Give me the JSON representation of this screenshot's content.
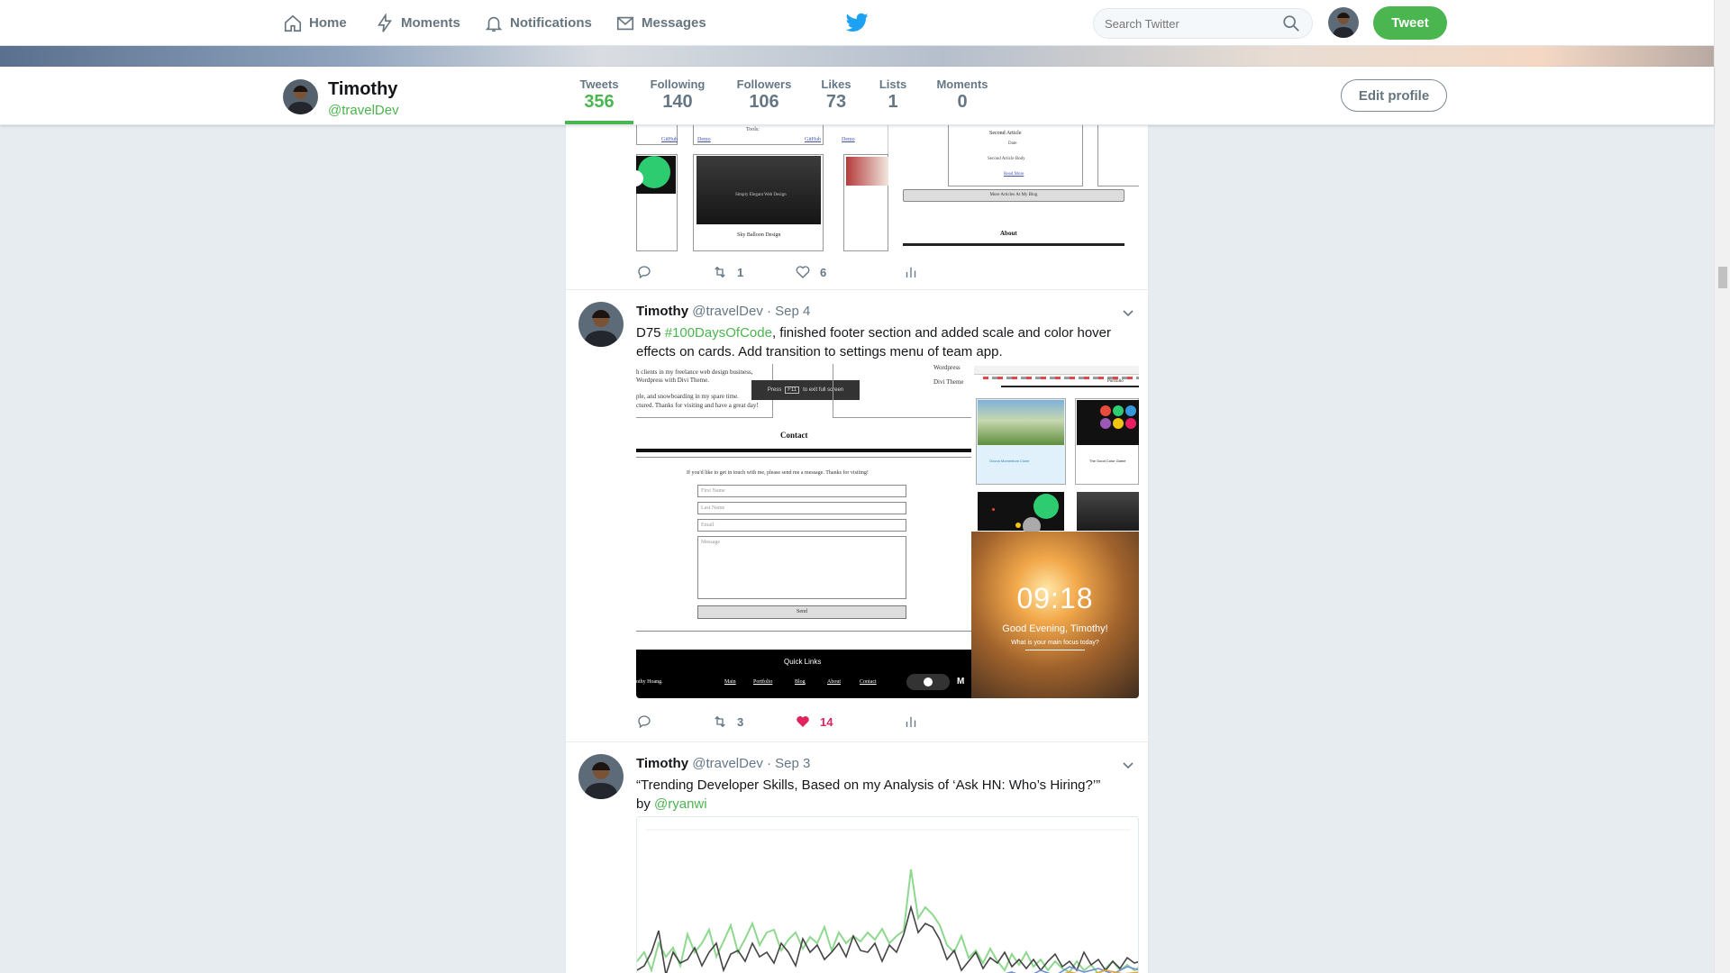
{
  "nav": {
    "home": "Home",
    "moments": "Moments",
    "notifications": "Notifications",
    "messages": "Messages",
    "search_placeholder": "Search Twitter",
    "tweet_button": "Tweet"
  },
  "profile": {
    "name": "Timothy",
    "handle": "@travelDev",
    "edit_button": "Edit profile",
    "stats": [
      {
        "label": "Tweets",
        "value": "356"
      },
      {
        "label": "Following",
        "value": "140"
      },
      {
        "label": "Followers",
        "value": "106"
      },
      {
        "label": "Likes",
        "value": "73"
      },
      {
        "label": "Lists",
        "value": "1"
      },
      {
        "label": "Moments",
        "value": "0"
      }
    ]
  },
  "tweets": [
    {
      "retweets": "1",
      "likes": "6",
      "media": {
        "github_a": "GitHub",
        "demo_a": "Demo",
        "tools": "Tools:",
        "demo_b": "Demo",
        "github_b": "GitHub",
        "demo_c": "Demo",
        "sky_caption": "Simply Elegant Web Design",
        "sky_title": "Sky Balloon Design",
        "second_article": "Second Article",
        "date": "Date",
        "article_body": "Second Article Body",
        "read_more": "Read More",
        "more_articles": "More Articles At My Blog",
        "about": "About"
      }
    },
    {
      "name": "Timothy",
      "handle": "@travelDev",
      "date": "· Sep 4",
      "text_pre": "D75 ",
      "hashtag": "#100DaysOfCode",
      "text_post": ", finished footer section and added scale and color hover effects on cards. Add transition to settings menu of team app.",
      "retweets": "3",
      "likes": "14",
      "media": {
        "bio_line1": "h clients in my freelance web design business,",
        "bio_line2": "Wordpress with Divi Theme.",
        "bio_line3": "ple, and snowboarding in my spare time.",
        "bio_line4": "ctured. Thanks for visiting and have a great day!",
        "fullscreen_pre": "Press",
        "fullscreen_key": "F11",
        "fullscreen_post": "to exit full screen",
        "wordpress": "Wordpress",
        "divi": "Divi Theme",
        "contact": "Contact",
        "contact_msg": "If you'd like to get in touch with me, please send me a message. Thanks for visiting!",
        "first_name": "First Name",
        "last_name": "Last Name",
        "email": "Email",
        "message": "Message",
        "send": "Send",
        "quick_links": "Quick Links",
        "footer_name": "othy Hoang.",
        "link_main": "Main",
        "link_portfolio": "Portfolio",
        "link_blog": "Blog",
        "link_about": "About",
        "link_contact": "Contact",
        "portfolio": "Portfolio",
        "clock": "09:18",
        "greeting": "Good Evening, Timothy!",
        "focus": "What is your main focus today?",
        "card1_title": "Ocuna Momentum Clone",
        "card2_title": "The Good Color Game"
      }
    },
    {
      "name": "Timothy",
      "handle": "@travelDev",
      "date": "· Sep 3",
      "text_line1": "“Trending Developer Skills, Based on my Analysis of ‘Ask HN: Who’s Hiring?’”",
      "text_by": "by ",
      "mention": "@ryanwi"
    }
  ],
  "colors": {
    "accent": "#4bb54f",
    "like": "#e0245e",
    "muted": "#657786"
  }
}
